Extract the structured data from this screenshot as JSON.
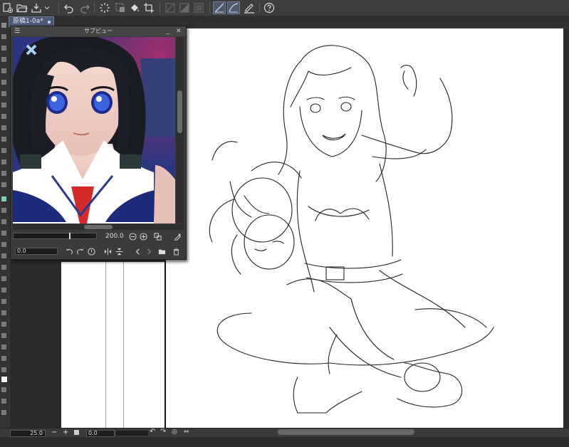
{
  "document": {
    "tab_label": "原稿1-0a*"
  },
  "subview": {
    "title": "サブビュー",
    "zoom_value": "200.0",
    "angle_value": "0.0"
  },
  "status": {
    "zoom_value": "25.0",
    "angle_value": "0.0"
  },
  "colors": {
    "chrome": "#3d3d3d",
    "canvas": "#ffffff",
    "tab_active": "#4b5a74",
    "tool_active": "#505a6a"
  },
  "toolbar_icons": [
    "new-canvas-icon",
    "open-folder-icon",
    "save-icon",
    "dropdown-icon",
    "undo-icon",
    "redo-icon",
    "loading-icon",
    "select-clear-icon",
    "fill-icon",
    "crop-icon",
    "snap-off-icon",
    "snap-gradient-icon",
    "snap-frame-icon",
    "ruler-snap-icon",
    "curve-snap-icon",
    "pen-ruler-icon",
    "help-icon"
  ]
}
